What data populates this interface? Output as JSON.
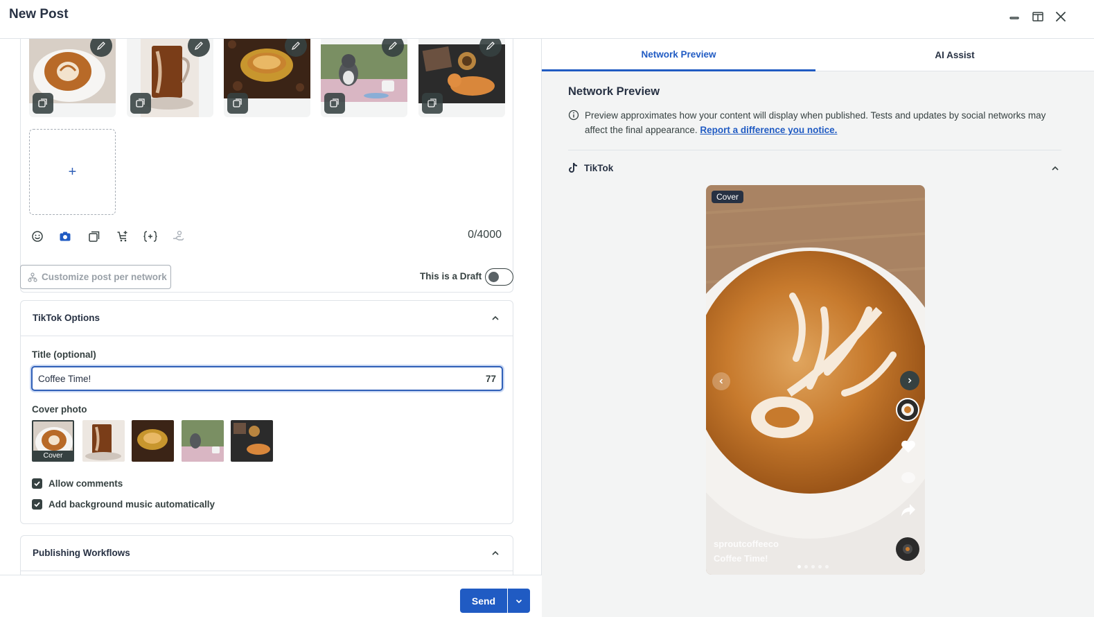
{
  "window": {
    "title": "New Post"
  },
  "composer": {
    "char_count": "0/4000",
    "add_media_symbol": "+",
    "toolbar_icons": [
      "emoji-icon",
      "camera-icon",
      "gallery-icon",
      "cart-plus-icon",
      "variables-icon",
      "hand-icon"
    ]
  },
  "options": {
    "customize_label": "Customize post per network",
    "draft_label": "This is a Draft"
  },
  "tiktok_options": {
    "header": "TikTok Options",
    "title_label": "Title (optional)",
    "title_value": "Coffee Time!",
    "title_remaining": "77",
    "cover_label": "Cover photo",
    "cover_tag": "Cover",
    "allow_comments": "Allow comments",
    "bg_music": "Add background music automatically"
  },
  "publishing": {
    "header": "Publishing Workflows"
  },
  "footer": {
    "send_label": "Send"
  },
  "right_panel": {
    "tabs": [
      "Network Preview",
      "AI Assist"
    ],
    "title": "Network Preview",
    "info_text": "Preview approximates how your content will display when published. Tests and updates by social networks may affect the final appearance.",
    "info_link": "Report a difference you notice.",
    "network_name": "TikTok",
    "preview": {
      "cover_chip": "Cover",
      "handle": "sproutcoffeeco",
      "caption": "Coffee Time!"
    }
  },
  "colors": {
    "accent": "#205bc3",
    "dark": "#364141",
    "border": "#dfe3e8",
    "panel_bg": "#f3f4f4"
  }
}
